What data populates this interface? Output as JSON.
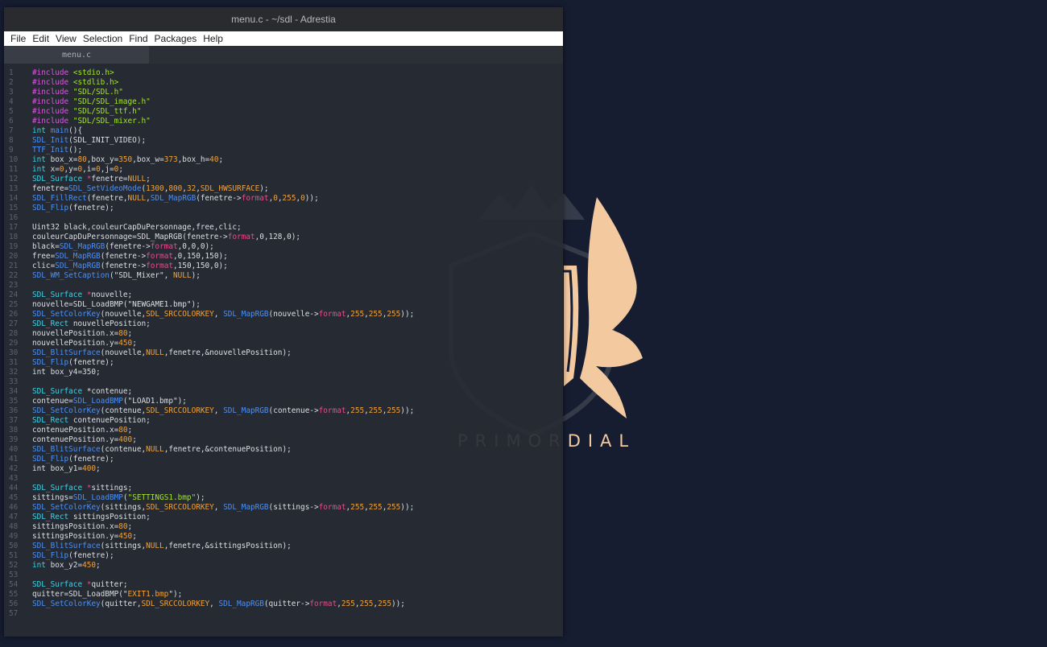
{
  "window": {
    "title": "menu.c - ~/sdl - Adrestia",
    "menu": [
      "File",
      "Edit",
      "View",
      "Selection",
      "Find",
      "Packages",
      "Help"
    ],
    "tab": "menu.c"
  },
  "wallpaper": {
    "caption": "PRIMORDIAL",
    "accent": "#f3c9a0"
  },
  "colors": {
    "keyword": "#36d0e2",
    "preprocessor": "#d35ad9",
    "string": "#a6e22e",
    "function": "#4e8ff0",
    "number": "#f2a137",
    "field": "#e24c8f",
    "plain": "#dcdfe4"
  },
  "code": [
    [
      [
        "pp",
        "#include "
      ],
      [
        "str",
        "<stdio.h>"
      ]
    ],
    [
      [
        "pp",
        "#include "
      ],
      [
        "str",
        "<stdlib.h>"
      ]
    ],
    [
      [
        "pp",
        "#include "
      ],
      [
        "str",
        "\"SDL/SDL.h\""
      ]
    ],
    [
      [
        "pp",
        "#include "
      ],
      [
        "str",
        "\"SDL/SDL_image.h\""
      ]
    ],
    [
      [
        "pp",
        "#include "
      ],
      [
        "str",
        "\"SDL/SDL_ttf.h\""
      ]
    ],
    [
      [
        "pp",
        "#include "
      ],
      [
        "str",
        "\"SDL/SDL_mixer.h\""
      ]
    ],
    [
      [
        "kw",
        "int "
      ],
      [
        "fn",
        "main"
      ],
      [
        "pl",
        "(){"
      ]
    ],
    [
      [
        "fn",
        "SDL_Init"
      ],
      [
        "pl",
        "(SDL_INIT_VIDEO);"
      ]
    ],
    [
      [
        "fn",
        "TTF_Init"
      ],
      [
        "pl",
        "();"
      ]
    ],
    [
      [
        "kw",
        "int "
      ],
      [
        "pl",
        "box_x="
      ],
      [
        "num",
        "80"
      ],
      [
        "pl",
        ",box_y="
      ],
      [
        "num",
        "350"
      ],
      [
        "pl",
        ",box_w="
      ],
      [
        "num",
        "373"
      ],
      [
        "pl",
        ",box_h="
      ],
      [
        "num",
        "40"
      ],
      [
        "pl",
        ";"
      ]
    ],
    [
      [
        "kw",
        "int "
      ],
      [
        "pl",
        "x="
      ],
      [
        "num",
        "0"
      ],
      [
        "pl",
        ",y="
      ],
      [
        "num",
        "0"
      ],
      [
        "pl",
        ",i="
      ],
      [
        "num",
        "0"
      ],
      [
        "pl",
        ",j="
      ],
      [
        "num",
        "0"
      ],
      [
        "pl",
        ";"
      ]
    ],
    [
      [
        "typ",
        "SDL_Surface "
      ],
      [
        "op",
        "*"
      ],
      [
        "pl",
        "fenetre="
      ],
      [
        "num",
        "NULL"
      ],
      [
        "pl",
        ";"
      ]
    ],
    [
      [
        "pl",
        "fenetre="
      ],
      [
        "fn",
        "SDL_SetVideoMode"
      ],
      [
        "pl",
        "("
      ],
      [
        "num",
        "1300"
      ],
      [
        "pl",
        ","
      ],
      [
        "num",
        "800"
      ],
      [
        "pl",
        ","
      ],
      [
        "num",
        "32"
      ],
      [
        "pl",
        ","
      ],
      [
        "num",
        "SDL_HWSURFACE"
      ],
      [
        "pl",
        ");"
      ]
    ],
    [
      [
        "fn",
        "SDL_FillRect"
      ],
      [
        "pl",
        "(fenetre,"
      ],
      [
        "num",
        "NULL"
      ],
      [
        "pl",
        ","
      ],
      [
        "fn",
        "SDL_MapRGB"
      ],
      [
        "pl",
        "(fenetre->"
      ],
      [
        "fld",
        "format"
      ],
      [
        "pl",
        ","
      ],
      [
        "num",
        "0"
      ],
      [
        "pl",
        ","
      ],
      [
        "num",
        "255"
      ],
      [
        "pl",
        ","
      ],
      [
        "num",
        "0"
      ],
      [
        "pl",
        "));"
      ]
    ],
    [
      [
        "fn",
        "SDL_Flip"
      ],
      [
        "pl",
        "(fenetre);"
      ]
    ],
    [],
    [
      [
        "pl",
        "Uint32 black,couleurCapDuPersonnage,free,clic;"
      ]
    ],
    [
      [
        "pl",
        "couleurCapDuPersonnage=SDL_MapRGB(fenetre->"
      ],
      [
        "fld",
        "format"
      ],
      [
        "pl",
        ",0,128,0);"
      ]
    ],
    [
      [
        "pl",
        "black="
      ],
      [
        "fn",
        "SDL_MapRGB"
      ],
      [
        "pl",
        "(fenetre->"
      ],
      [
        "fld",
        "format"
      ],
      [
        "pl",
        ",0,0,0);"
      ]
    ],
    [
      [
        "pl",
        "free="
      ],
      [
        "fn",
        "SDL_MapRGB"
      ],
      [
        "pl",
        "(fenetre->"
      ],
      [
        "fld",
        "format"
      ],
      [
        "pl",
        ",0,150,150);"
      ]
    ],
    [
      [
        "pl",
        "clic="
      ],
      [
        "fn",
        "SDL_MapRGB"
      ],
      [
        "pl",
        "(fenetre->"
      ],
      [
        "fld",
        "format"
      ],
      [
        "pl",
        ",150,150,0);"
      ]
    ],
    [
      [
        "fn",
        "SDL_WM_SetCaption"
      ],
      [
        "pl",
        "(\"SDL_Mixer\", "
      ],
      [
        "num",
        "NULL"
      ],
      [
        "pl",
        ");"
      ]
    ],
    [],
    [
      [
        "typ",
        "SDL_Surface "
      ],
      [
        "op",
        "*"
      ],
      [
        "pl",
        "nouvelle;"
      ]
    ],
    [
      [
        "pl",
        "nouvelle=SDL_LoadBMP(\"NEWGAME1.bmp\");"
      ]
    ],
    [
      [
        "fn",
        "SDL_SetColorKey"
      ],
      [
        "pl",
        "(nouvelle,"
      ],
      [
        "num",
        "SDL_SRCCOLORKEY"
      ],
      [
        "pl",
        ", "
      ],
      [
        "fn",
        "SDL_MapRGB"
      ],
      [
        "pl",
        "(nouvelle->"
      ],
      [
        "fld",
        "format"
      ],
      [
        "pl",
        ","
      ],
      [
        "num",
        "255"
      ],
      [
        "pl",
        ","
      ],
      [
        "num",
        "255"
      ],
      [
        "pl",
        ","
      ],
      [
        "num",
        "255"
      ],
      [
        "pl",
        "));"
      ]
    ],
    [
      [
        "typ",
        "SDL_Rect "
      ],
      [
        "pl",
        "nouvellePosition;"
      ]
    ],
    [
      [
        "pl",
        "nouvellePosition.x="
      ],
      [
        "num",
        "80"
      ],
      [
        "pl",
        ";"
      ]
    ],
    [
      [
        "pl",
        "nouvellePosition.y="
      ],
      [
        "num",
        "450"
      ],
      [
        "pl",
        ";"
      ]
    ],
    [
      [
        "fn",
        "SDL_BlitSurface"
      ],
      [
        "pl",
        "(nouvelle,"
      ],
      [
        "num",
        "NULL"
      ],
      [
        "pl",
        ",fenetre,&nouvellePosition);"
      ]
    ],
    [
      [
        "fn",
        "SDL_Flip"
      ],
      [
        "pl",
        "(fenetre);"
      ]
    ],
    [
      [
        "pl",
        "int box_y4=350;"
      ]
    ],
    [],
    [
      [
        "typ",
        "SDL_Surface "
      ],
      [
        "pl",
        "*contenue;"
      ]
    ],
    [
      [
        "pl",
        "contenue="
      ],
      [
        "fn",
        "SDL_LoadBMP"
      ],
      [
        "pl",
        "(\"LOAD1.bmp\");"
      ]
    ],
    [
      [
        "fn",
        "SDL_SetColorKey"
      ],
      [
        "pl",
        "(contenue,"
      ],
      [
        "num",
        "SDL_SRCCOLORKEY"
      ],
      [
        "pl",
        ", "
      ],
      [
        "fn",
        "SDL_MapRGB"
      ],
      [
        "pl",
        "(contenue->"
      ],
      [
        "fld",
        "format"
      ],
      [
        "pl",
        ","
      ],
      [
        "num",
        "255"
      ],
      [
        "pl",
        ","
      ],
      [
        "num",
        "255"
      ],
      [
        "pl",
        ","
      ],
      [
        "num",
        "255"
      ],
      [
        "pl",
        "));"
      ]
    ],
    [
      [
        "typ",
        "SDL_Rect "
      ],
      [
        "pl",
        "contenuePosition;"
      ]
    ],
    [
      [
        "pl",
        "contenuePosition.x="
      ],
      [
        "num",
        "80"
      ],
      [
        "pl",
        ";"
      ]
    ],
    [
      [
        "pl",
        "contenuePosition.y="
      ],
      [
        "num",
        "400"
      ],
      [
        "pl",
        ";"
      ]
    ],
    [
      [
        "fn",
        "SDL_BlitSurface"
      ],
      [
        "pl",
        "(contenue,"
      ],
      [
        "num",
        "NULL"
      ],
      [
        "pl",
        ",fenetre,&contenuePosition);"
      ]
    ],
    [
      [
        "fn",
        "SDL_Flip"
      ],
      [
        "pl",
        "(fenetre);"
      ]
    ],
    [
      [
        "pl",
        "int box_y1="
      ],
      [
        "num",
        "400"
      ],
      [
        "pl",
        ";"
      ]
    ],
    [],
    [
      [
        "typ",
        "SDL_Surface "
      ],
      [
        "op",
        "*"
      ],
      [
        "pl",
        "sittings;"
      ]
    ],
    [
      [
        "pl",
        "sittings="
      ],
      [
        "fn",
        "SDL_LoadBMP"
      ],
      [
        "pl",
        "("
      ],
      [
        "str",
        "\"SETTINGS1.bmp\""
      ],
      [
        "pl",
        ");"
      ]
    ],
    [
      [
        "fn",
        "SDL_SetColorKey"
      ],
      [
        "pl",
        "(sittings,"
      ],
      [
        "num",
        "SDL_SRCCOLORKEY"
      ],
      [
        "pl",
        ", "
      ],
      [
        "fn",
        "SDL_MapRGB"
      ],
      [
        "pl",
        "(sittings->"
      ],
      [
        "fld",
        "format"
      ],
      [
        "pl",
        ","
      ],
      [
        "num",
        "255"
      ],
      [
        "pl",
        ","
      ],
      [
        "num",
        "255"
      ],
      [
        "pl",
        ","
      ],
      [
        "num",
        "255"
      ],
      [
        "pl",
        "));"
      ]
    ],
    [
      [
        "typ",
        "SDL_Rect "
      ],
      [
        "pl",
        "sittingsPosition;"
      ]
    ],
    [
      [
        "pl",
        "sittingsPosition.x="
      ],
      [
        "num",
        "80"
      ],
      [
        "pl",
        ";"
      ]
    ],
    [
      [
        "pl",
        "sittingsPosition.y="
      ],
      [
        "num",
        "450"
      ],
      [
        "pl",
        ";"
      ]
    ],
    [
      [
        "fn",
        "SDL_BlitSurface"
      ],
      [
        "pl",
        "(sittings,"
      ],
      [
        "num",
        "NULL"
      ],
      [
        "pl",
        ",fenetre,&sittingsPosition);"
      ]
    ],
    [
      [
        "fn",
        "SDL_Flip"
      ],
      [
        "pl",
        "(fenetre);"
      ]
    ],
    [
      [
        "kw",
        "int "
      ],
      [
        "pl",
        "box_y2="
      ],
      [
        "num",
        "450"
      ],
      [
        "pl",
        ";"
      ]
    ],
    [],
    [
      [
        "typ",
        "SDL_Surface "
      ],
      [
        "op",
        "*"
      ],
      [
        "pl",
        "quitter;"
      ]
    ],
    [
      [
        "pl",
        "quitter=SDL_LoadBMP(\""
      ],
      [
        "num",
        "EXIT1.bmp"
      ],
      [
        "pl",
        "\");"
      ]
    ],
    [
      [
        "fn",
        "SDL_SetColorKey"
      ],
      [
        "pl",
        "(quitter,"
      ],
      [
        "num",
        "SDL_SRCCOLORKEY"
      ],
      [
        "pl",
        ", "
      ],
      [
        "fn",
        "SDL_MapRGB"
      ],
      [
        "pl",
        "(quitter->"
      ],
      [
        "fld",
        "format"
      ],
      [
        "pl",
        ","
      ],
      [
        "num",
        "255"
      ],
      [
        "pl",
        ","
      ],
      [
        "num",
        "255"
      ],
      [
        "pl",
        ","
      ],
      [
        "num",
        "255"
      ],
      [
        "pl",
        "));"
      ]
    ],
    []
  ]
}
